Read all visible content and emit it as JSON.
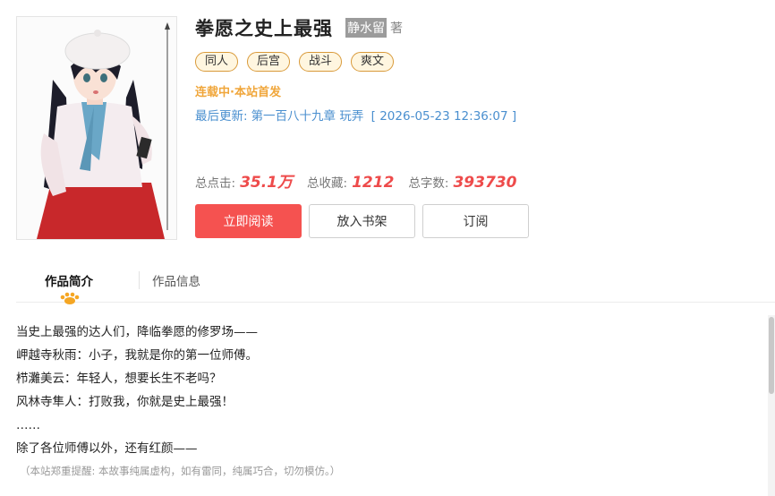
{
  "book": {
    "title": "拳愿之史上最强",
    "author": "静水留",
    "author_suffix": "著",
    "tags": [
      "同人",
      "后宫",
      "战斗",
      "爽文"
    ],
    "status": "连载中·本站首发",
    "update_label": "最后更新:",
    "latest_chapter": "第一百八十九章 玩弄",
    "update_time": "[ 2026-05-23 12:36:07 ]"
  },
  "stats": {
    "clicks_label": "总点击:",
    "clicks_value": "35.1万",
    "favorites_label": "总收藏:",
    "favorites_value": "1212",
    "words_label": "总字数:",
    "words_value": "393730"
  },
  "actions": {
    "read_label": "立即阅读",
    "shelf_label": "放入书架",
    "subscribe_label": "订阅"
  },
  "tabs": [
    {
      "label": "作品简介",
      "active": true
    },
    {
      "label": "作品信息",
      "active": false
    }
  ],
  "intro": {
    "lines": [
      "当史上最强的达人们，降临拳愿的修罗场——",
      "岬越寺秋雨：小子，我就是你的第一位师傅。",
      "栉灘美云：年轻人，想要长生不老吗？",
      "风林寺隼人：打败我，你就是史上最强！",
      "……",
      "除了各位师傅以外，还有红颜——"
    ],
    "disclaimer": "（本站郑重提醒: 本故事纯属虚构，如有雷同，纯属巧合，切勿模仿。）"
  },
  "colors": {
    "accent_red": "#f55250",
    "stat_red": "#ee4b4b",
    "status_orange": "#f0a63a",
    "link_blue": "#4a8fcf",
    "tag_border": "#d99a3a",
    "tag_bg": "#fff6e0"
  },
  "icons": {
    "tab_indicator": "paw-icon"
  }
}
